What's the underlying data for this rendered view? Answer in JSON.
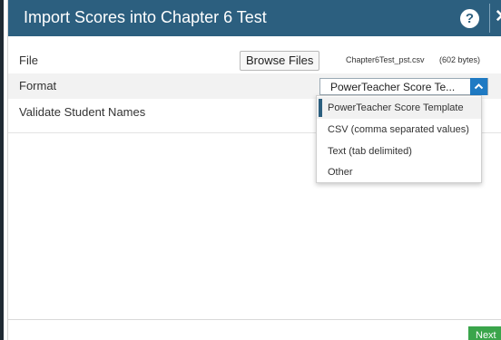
{
  "dialog": {
    "title": "Import Scores into Chapter 6 Test",
    "help_label": "?",
    "close_label": "✕"
  },
  "file_row": {
    "label": "File",
    "browse_label": "Browse Files",
    "file_name": "Chapter6Test_pst.csv",
    "file_size": "(602 bytes)"
  },
  "format_row": {
    "label": "Format",
    "selected_value": "PowerTeacher Score Te...",
    "options": [
      "PowerTeacher Score Template",
      "CSV (comma separated values)",
      "Text (tab delimited)",
      "Other"
    ],
    "selected_index": 0
  },
  "validate_row": {
    "label": "Validate Student Names"
  },
  "footer": {
    "next_label": "Next"
  },
  "colors": {
    "titlebar": "#2c5f7f",
    "select_arrow": "#1f7ac3",
    "next_button": "#3aa54b"
  },
  "icons": {
    "help": "question-circle-icon",
    "close": "close-icon",
    "select_arrow": "chevron-up-icon"
  }
}
